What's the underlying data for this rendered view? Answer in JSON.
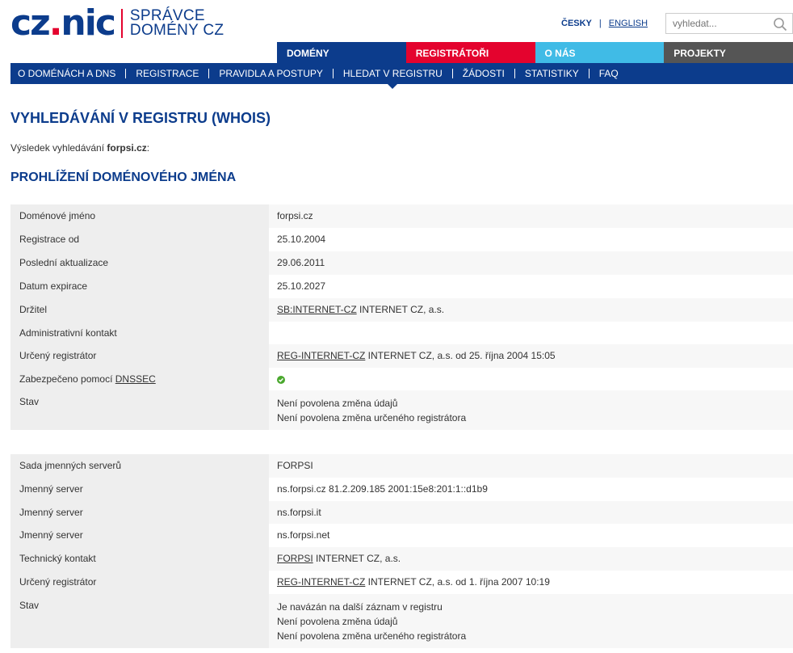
{
  "logo": {
    "mark_left": "cz",
    "mark_dot": ".",
    "mark_right": "nic",
    "text_line1": "SPRÁVCE",
    "text_line2": "DOMÉNY CZ"
  },
  "lang": {
    "active": "ČESKY",
    "sep": "|",
    "other": "ENGLISH"
  },
  "search": {
    "placeholder": "vyhledat..."
  },
  "cat_tabs": [
    "DOMÉNY",
    "REGISTRÁTOŘI",
    "O NÁS",
    "PROJEKTY"
  ],
  "subnav": [
    "O DOMÉNÁCH A DNS",
    "REGISTRACE",
    "PRAVIDLA A POSTUPY",
    "HLEDAT V REGISTRU",
    "ŽÁDOSTI",
    "STATISTIKY",
    "FAQ"
  ],
  "page": {
    "title": "VYHLEDÁVÁNÍ V REGISTRU (WHOIS)",
    "result_prefix": "Výsledek vyhledávání ",
    "result_query": "forpsi.cz",
    "result_suffix": ":",
    "section_title": "PROHLÍŽENÍ DOMÉNOVÉHO JMÉNA"
  },
  "domain_table": {
    "domain_label": "Doménové jméno",
    "domain_value": "forpsi.cz",
    "registered_label": "Registrace od",
    "registered_value": "25.10.2004",
    "updated_label": "Poslední aktualizace",
    "updated_value": "29.06.2011",
    "expiry_label": "Datum expirace",
    "expiry_value": "25.10.2027",
    "holder_label": "Držitel",
    "holder_link": "SB:INTERNET-CZ",
    "holder_name": " INTERNET CZ, a.s.",
    "admin_label": "Administrativní kontakt",
    "registrar_label": "Určený registrátor",
    "registrar_link": "REG-INTERNET-CZ",
    "registrar_text": " INTERNET CZ, a.s. od 25. října 2004 15:05",
    "dnssec_label_prefix": "Zabezpečeno pomocí ",
    "dnssec_link": "DNSSEC",
    "status_label": "Stav",
    "status_lines": [
      "Není povolena změna údajů",
      "Není povolena změna určeného registrátora"
    ]
  },
  "ns_table": {
    "set_label": "Sada jmenných serverů",
    "set_value": "FORPSI",
    "ns_label": "Jmenný server",
    "ns1": "ns.forpsi.cz 81.2.209.185 2001:15e8:201:1::d1b9",
    "ns2": "ns.forpsi.it",
    "ns3": "ns.forpsi.net",
    "tech_label": "Technický kontakt",
    "tech_link": "FORPSI",
    "tech_name": " INTERNET CZ, a.s.",
    "registrar_label": "Určený registrátor",
    "registrar_link": "REG-INTERNET-CZ",
    "registrar_text": " INTERNET CZ, a.s. od 1. října 2007 10:19",
    "status_label": "Stav",
    "status_lines": [
      "Je navázán na další záznam v registru",
      "Není povolena změna údajů",
      "Není povolena změna určeného registrátora"
    ]
  },
  "colors": {
    "brand_blue": "#0c3c8c",
    "brand_red": "#e4032e",
    "brand_cyan": "#40bbe6",
    "gray_tab": "#555555",
    "ok_green": "#4aa82e"
  }
}
